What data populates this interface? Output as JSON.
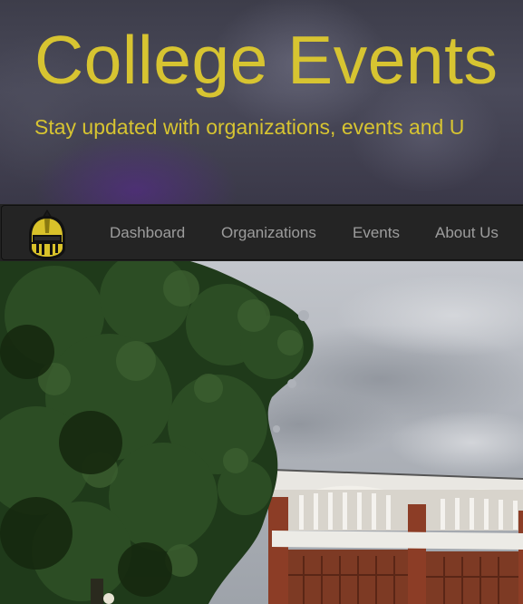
{
  "header": {
    "title": "College Events",
    "subtitle": "Stay updated with organizations, events and U"
  },
  "navbar": {
    "logo_icon": "knight-helmet-icon",
    "items": [
      {
        "label": "Dashboard"
      },
      {
        "label": "Organizations"
      },
      {
        "label": "Events"
      },
      {
        "label": "About Us"
      }
    ]
  },
  "hero_image": {
    "subject": "campus-building-photo"
  },
  "colors": {
    "accent_gold": "#d7c431",
    "navbar_bg": "#242424",
    "nav_link": "#9d9d9d"
  }
}
